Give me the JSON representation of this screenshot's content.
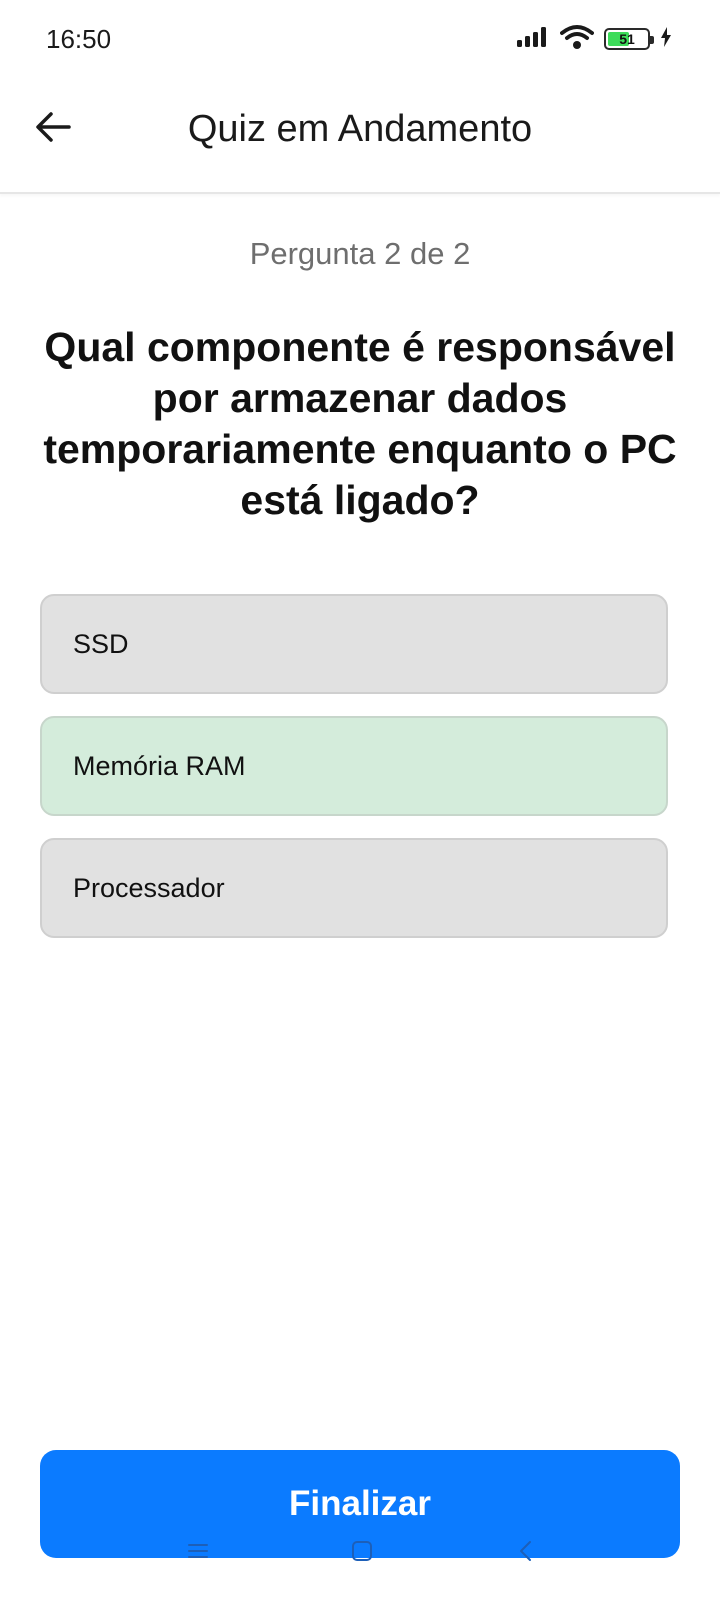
{
  "status_bar": {
    "time": "16:50",
    "battery_level": "51",
    "icons": [
      "signal-icon",
      "wifi-icon",
      "battery-icon",
      "charging-icon"
    ]
  },
  "app_bar": {
    "title": "Quiz em Andamento",
    "back_icon": "arrow-left-icon"
  },
  "quiz": {
    "progress": "Pergunta 2 de 2",
    "question": "Qual componente é responsável por armazenar dados temporariamente enquanto o PC está ligado?",
    "options": [
      {
        "label": "SSD",
        "selected": false
      },
      {
        "label": "Memória RAM",
        "selected": true
      },
      {
        "label": "Processador",
        "selected": false
      }
    ]
  },
  "footer": {
    "finish_label": "Finalizar"
  },
  "colors": {
    "primary": "#0b7bff",
    "selected_option": "#d4ecdb",
    "option_background": "#e1e1e1"
  },
  "system_nav": [
    "menu-icon",
    "home-icon",
    "back-chevron-icon"
  ]
}
